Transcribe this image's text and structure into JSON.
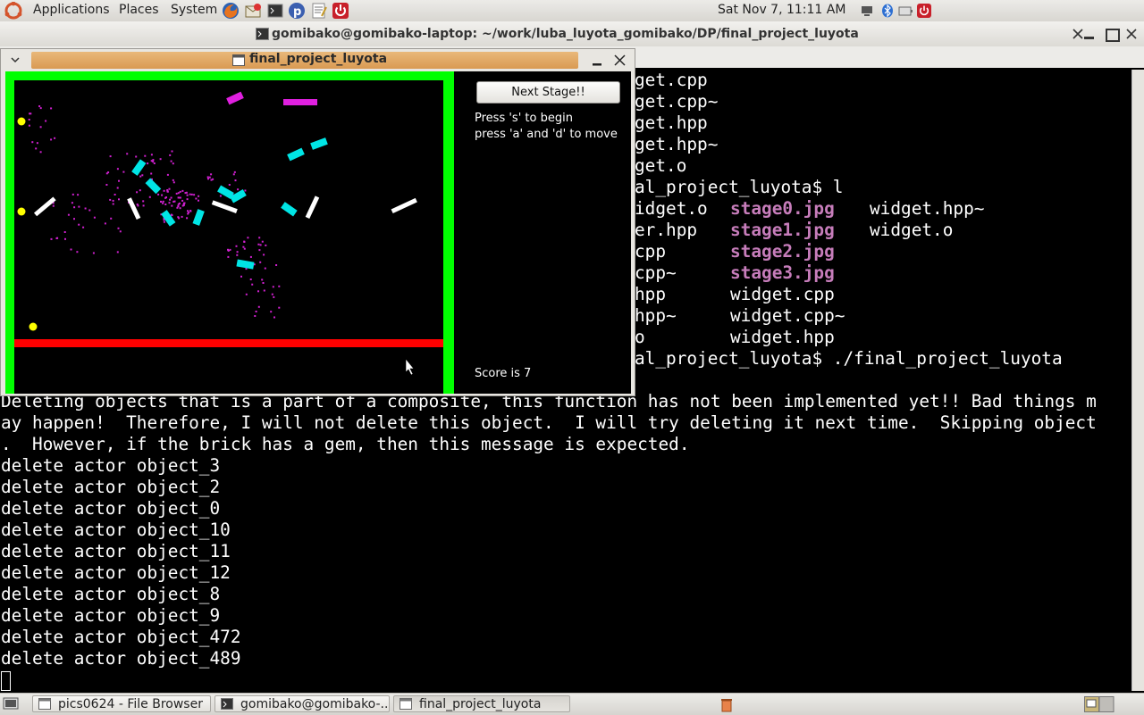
{
  "top_panel": {
    "menus": [
      "Applications",
      "Places",
      "System"
    ],
    "clock": "Sat Nov  7, 11:11 AM"
  },
  "terminal": {
    "title": "gomibako@gomibako-laptop: ~/work/luba_luyota_gomibako/DP/final_project_luyota",
    "partial_lines": [
      "get.cpp",
      "get.cpp~",
      "get.hpp",
      "get.hpp~",
      "get.o",
      "al_project_luyota$ l"
    ],
    "listing": [
      [
        "idget.o",
        "stage0.jpg",
        "widget.hpp~"
      ],
      [
        "er.hpp",
        "stage1.jpg",
        "widget.o"
      ],
      [
        "cpp",
        "stage2.jpg",
        ""
      ],
      [
        "cpp~",
        "stage3.jpg",
        ""
      ],
      [
        "hpp",
        "widget.cpp",
        ""
      ],
      [
        "hpp~",
        "widget.cpp~",
        ""
      ],
      [
        "o",
        "widget.hpp",
        ""
      ]
    ],
    "run_command": "al_project_luyota$ ./final_project_luyota",
    "output_lines": [
      "Deleting objects that is a part of a composite, this function has not been implemented yet!! Bad things m",
      "ay happen!  Therefore, I will not delete this object.  I will try deleting it next time.  Skipping object",
      ".  However, if the brick has a gem, then this message is expected.",
      "delete actor object_3",
      "delete actor object_2",
      "delete actor object_0",
      "delete actor object_10",
      "delete actor object_11",
      "delete actor object_12",
      "delete actor object_8",
      "delete actor object_9",
      "delete actor object_472",
      "delete actor object_489"
    ]
  },
  "game_window": {
    "title": "final_project_luyota",
    "next_button": "Next Stage!!",
    "instructions": [
      "Press 's' to begin",
      "press 'a' and 'd' to move"
    ],
    "score_text": "Score is 7"
  },
  "taskbar": {
    "items": [
      "pics0624 - File Browser",
      "gomibako@gomibako-...",
      "final_project_luyota"
    ]
  },
  "colors": {
    "wall": "#00ff00",
    "paddle": "#ff0000",
    "ball": "#ffff00",
    "brick_cyan": "#00e5e5",
    "brick_magenta": "#e020e0",
    "particle": "#d020d0",
    "title_active": "#d99a52"
  }
}
